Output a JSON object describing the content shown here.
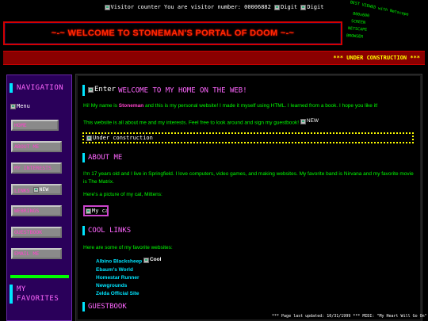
{
  "counter": {
    "text": "Visitor counter You are visitor number: 00006882",
    "digit_alt_1": "Digit",
    "digit_alt_2": "Digit"
  },
  "stamp": {
    "lines": [
      "BEST VIEWED with Netscape",
      "800x600",
      "SCREEN",
      "NETSCAPE",
      "BROWSER"
    ]
  },
  "header": {
    "title": "~-~ WELCOME TO STONEMAN'S PORTAL OF DOOM ~-~"
  },
  "marquee": {
    "text": "*** UNDER CONSTRUCTION ***"
  },
  "sidebar": {
    "navigation_heading": "NAVIGATION",
    "menu_img_alt": "Menu",
    "buttons": [
      {
        "label": "HOME"
      },
      {
        "label": "ABOUT ME"
      },
      {
        "label": "MY INTERESTS"
      },
      {
        "label": "LINKS",
        "badge_alt": "NEW"
      },
      {
        "label": "WEBRINGS"
      },
      {
        "label": "GUESTBOOK"
      },
      {
        "label": "EMAIL ME"
      }
    ],
    "favorites_heading_1": "MY",
    "favorites_heading_2": "FAVORITES"
  },
  "main": {
    "welcome": {
      "img_alt": "Enter",
      "title": "WELCOME TO MY HOME ON THE WEB!",
      "intro_before": "Hi! My name is ",
      "intro_name": "Stoneman",
      "intro_after": " and this is my personal website! I made it myself using HTML. I learned from a book. I hope you like it!",
      "line2": "This website is all about me and my interests. Feel free to look around and sign my guestbook!",
      "new_alt": "NEW",
      "construction_alt": "Under construction"
    },
    "about": {
      "title": "ABOUT ME",
      "para1": "I'm 17 years old and I live in Springfield. I love computers, video games, and making websites. My favorite band is Nirvana and my favorite movie is The Matrix.",
      "para2": "Here's a picture of my cat, Mittens:",
      "cat_alt": "My cat"
    },
    "links": {
      "title": "COOL LINKS",
      "intro": "Here are some of my favorite websites:",
      "items": [
        {
          "label": "Albino Blacksheep",
          "img_alt": "Cool"
        },
        {
          "label": "Ebaum's World"
        },
        {
          "label": "Homestar Runner"
        },
        {
          "label": "Newgrounds"
        },
        {
          "label": "Zelda Official Site"
        }
      ]
    },
    "guestbook": {
      "title": "GUESTBOOK"
    }
  },
  "footer": {
    "text": "*** Page last updated: 10/31/1999 *** MIDI: \"My Heart Will Go On\" by Celine"
  }
}
